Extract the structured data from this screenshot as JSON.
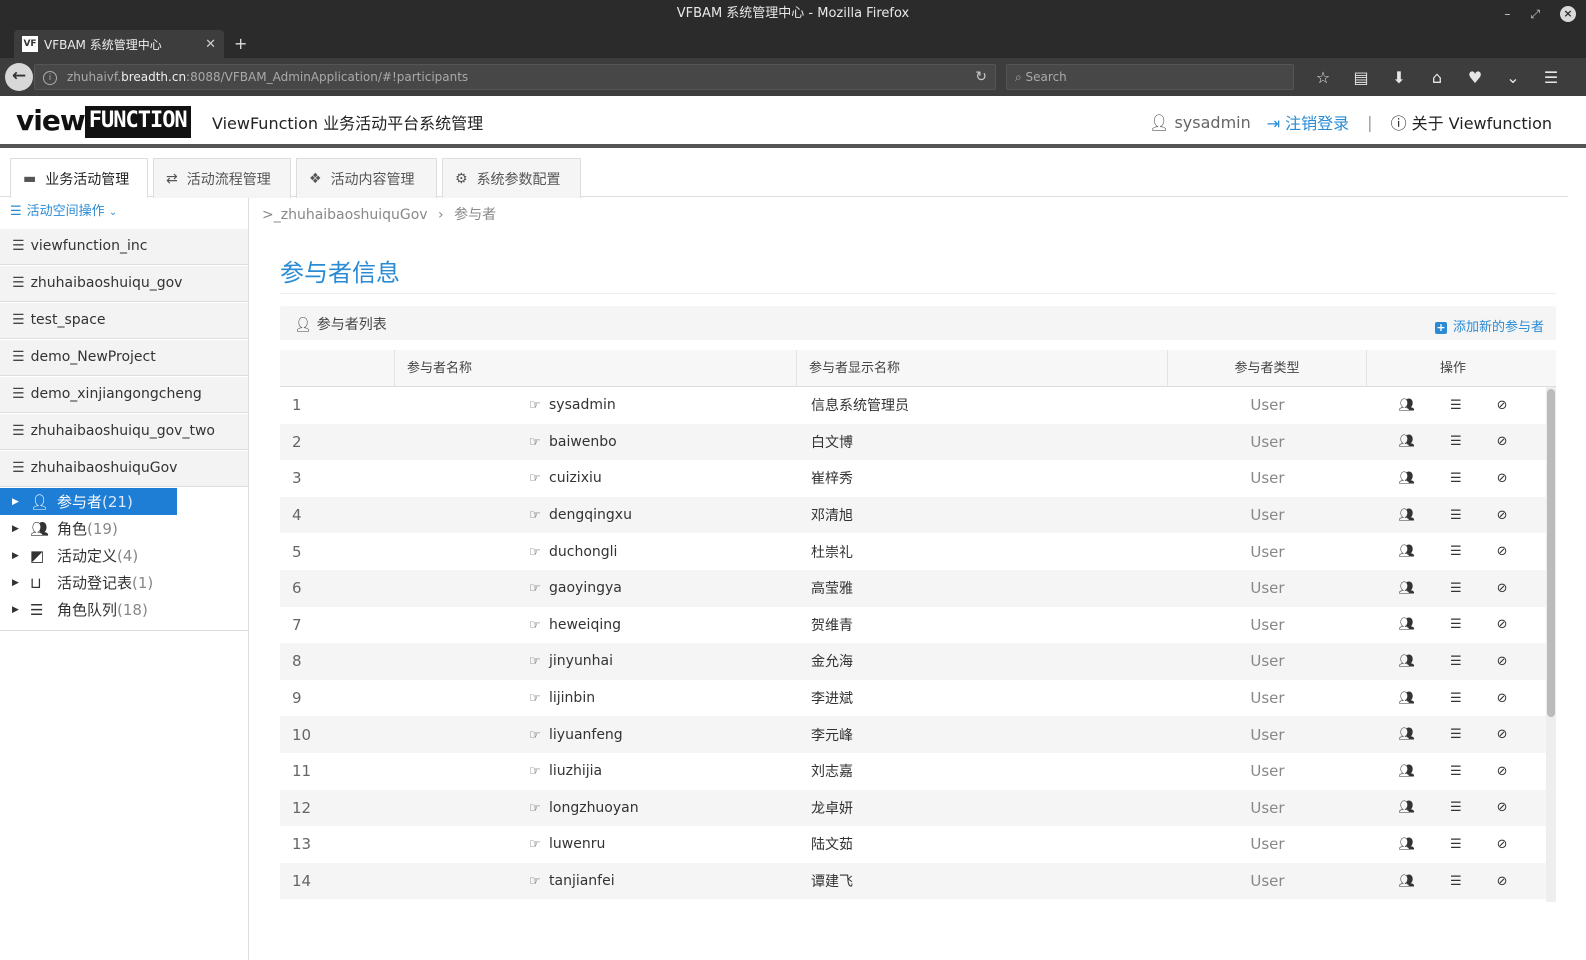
{
  "window": {
    "title": "VFBAM 系统管理中心 - Mozilla Firefox"
  },
  "browser": {
    "tab_title": "VFBAM 系统管理中心",
    "url_prefix": "zhuhaivf.",
    "url_host": "breadth.cn",
    "url_rest": ":8088/VFBAM_AdminApplication/#!participants",
    "search_placeholder": "Search"
  },
  "header": {
    "logo_part1": "view",
    "logo_part2": "FUNCTION",
    "app_title": "ViewFunction 业务活动平台系统管理",
    "username": "sysadmin",
    "logout": "注销登录",
    "separator": "|",
    "about": "关于 Viewfunction"
  },
  "main_tabs": [
    {
      "label": "业务活动管理",
      "icon": "archive-icon",
      "active": true
    },
    {
      "label": "活动流程管理",
      "icon": "retweet-icon",
      "active": false
    },
    {
      "label": "活动内容管理",
      "icon": "cubes-icon",
      "active": false
    },
    {
      "label": "系统参数配置",
      "icon": "cogs-icon",
      "active": false
    }
  ],
  "sidebar": {
    "space_ops": "活动空间操作",
    "spaces": [
      "viewfunction_inc",
      "zhuhaibaoshuiqu_gov",
      "test_space",
      "demo_NewProject",
      "demo_xinjiangongcheng",
      "zhuhaibaoshuiqu_gov_two",
      "zhuhaibaoshuiquGov"
    ],
    "tree": [
      {
        "label": "参与者",
        "count": "(21)",
        "icon": "user-icon",
        "active": true
      },
      {
        "label": "角色",
        "count": "(19)",
        "icon": "users-icon",
        "active": false
      },
      {
        "label": "活动定义",
        "count": "(4)",
        "icon": "share-square-icon",
        "active": false
      },
      {
        "label": "活动登记表",
        "count": "(1)",
        "icon": "inbox-icon",
        "active": false
      },
      {
        "label": "角色队列",
        "count": "(18)",
        "icon": "list-icon",
        "active": false
      }
    ]
  },
  "breadcrumb": {
    "space": "_zhuhaibaoshuiquGov",
    "current": "参与者"
  },
  "page": {
    "title": "参与者信息",
    "panel_title": "参与者列表",
    "add_button": "添加新的参与者"
  },
  "table": {
    "headers": [
      "",
      "参与者名称",
      "参与者显示名称",
      "参与者类型",
      "操作"
    ],
    "rows": [
      {
        "idx": "1",
        "name": "sysadmin",
        "display": "信息系统管理员",
        "type": "User"
      },
      {
        "idx": "2",
        "name": "baiwenbo",
        "display": "白文博",
        "type": "User"
      },
      {
        "idx": "3",
        "name": "cuizixiu",
        "display": "崔梓秀",
        "type": "User"
      },
      {
        "idx": "4",
        "name": "dengqingxu",
        "display": "邓清旭",
        "type": "User"
      },
      {
        "idx": "5",
        "name": "duchongli",
        "display": "杜崇礼",
        "type": "User"
      },
      {
        "idx": "6",
        "name": "gaoyingya",
        "display": "高莹雅",
        "type": "User"
      },
      {
        "idx": "7",
        "name": "heweiqing",
        "display": "贺维青",
        "type": "User"
      },
      {
        "idx": "8",
        "name": "jinyunhai",
        "display": "金允海",
        "type": "User"
      },
      {
        "idx": "9",
        "name": "lijinbin",
        "display": "李进斌",
        "type": "User"
      },
      {
        "idx": "10",
        "name": "liyuanfeng",
        "display": "李元峰",
        "type": "User"
      },
      {
        "idx": "11",
        "name": "liuzhijia",
        "display": "刘志嘉",
        "type": "User"
      },
      {
        "idx": "12",
        "name": "longzhuoyan",
        "display": "龙卓妍",
        "type": "User"
      },
      {
        "idx": "13",
        "name": "luwenru",
        "display": "陆文茹",
        "type": "User"
      },
      {
        "idx": "14",
        "name": "tanjianfei",
        "display": "谭建飞",
        "type": "User"
      }
    ]
  },
  "colors": {
    "accent": "#2a8bd4",
    "active_tree": "#1e7ed6"
  }
}
